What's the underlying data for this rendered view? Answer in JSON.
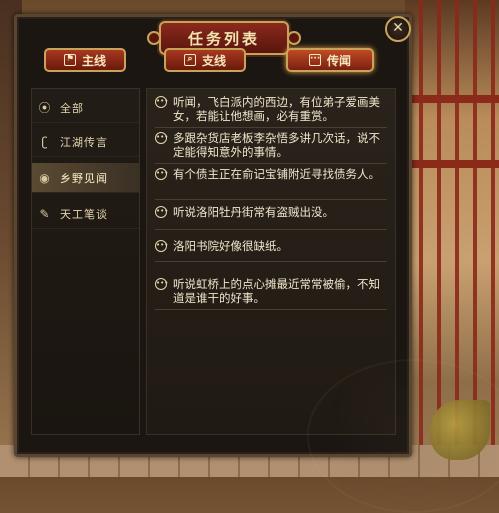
{
  "window": {
    "title": "任务列表",
    "close_glyph": "✕"
  },
  "tabs": [
    {
      "label": "主线",
      "icon": "flag-icon",
      "glyph": "⚑"
    },
    {
      "label": "支线",
      "icon": "search-icon",
      "glyph": "⌕"
    },
    {
      "label": "传闻",
      "icon": "speech-bubble-icon",
      "glyph": "···",
      "active": true
    }
  ],
  "categories": [
    {
      "label": "全部",
      "icon": "speech-bubble-icon",
      "glyph": "⦿"
    },
    {
      "label": "江湖传言",
      "icon": "ear-icon",
      "glyph": "ʗ"
    },
    {
      "label": "乡野见闻",
      "icon": "eye-icon",
      "glyph": "◉",
      "active": true
    },
    {
      "label": "天工笔谈",
      "icon": "brush-icon",
      "glyph": "✎"
    }
  ],
  "entries": [
    {
      "text": "听闻，飞白派内的西边，有位弟子爱画美女，若能让他想画，必有重赏。"
    },
    {
      "text": "多跟杂货店老板李杂悟多讲几次话，说不定能得知意外的事情。"
    },
    {
      "text": "有个债主正在俞记宝铺附近寻找债务人。"
    },
    {
      "text": "听说洛阳牡丹街常有盗贼出没。"
    },
    {
      "text": "洛阳书院好像很缺纸。"
    },
    {
      "text": "听说虹桥上的点心摊最近常常被偷，不知道是谁干的好事。"
    }
  ],
  "colors": {
    "tab_red": "#a8381f",
    "gold_border": "#c9a35a",
    "text": "#f0e6cc"
  }
}
